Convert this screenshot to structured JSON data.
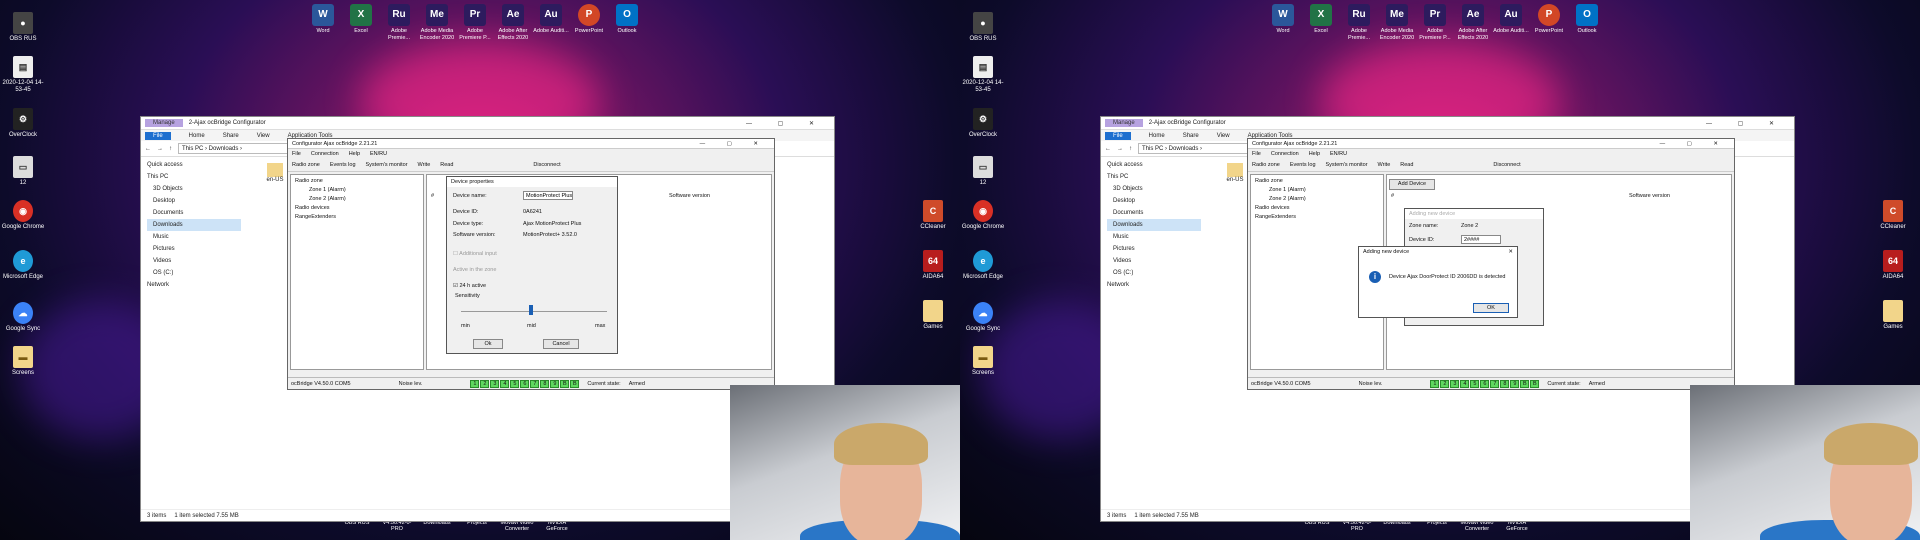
{
  "left": {
    "desktop_left": [
      {
        "label": "OBS RUS",
        "icon": "obs-icon",
        "color": "#444"
      },
      {
        "label": "2020-12-04 14-53-45",
        "icon": "file-icon",
        "color": "#eee"
      },
      {
        "label": "OverClock",
        "icon": "overclock-icon",
        "color": "#222"
      },
      {
        "label": "12",
        "icon": "file-icon",
        "color": "#ddd"
      },
      {
        "label": "Google Chrome",
        "icon": "chrome-icon",
        "color": "#d93025"
      },
      {
        "label": "Microsoft Edge",
        "icon": "edge-icon",
        "color": "#1f9ad6"
      },
      {
        "label": "Google Sync",
        "icon": "google-sync-icon",
        "color": "#3b82f6"
      },
      {
        "label": "Screens",
        "icon": "folder-icon",
        "color": "#f2d58a"
      }
    ],
    "desktop_top": [
      {
        "label": "Word",
        "text": "W",
        "color": "#2b579a"
      },
      {
        "label": "Excel",
        "text": "X",
        "color": "#217346"
      },
      {
        "label": "Adobe Premie...",
        "text": "Ru",
        "color": "#2d1b5e"
      },
      {
        "label": "Adobe Media Encoder 2020",
        "text": "Me",
        "color": "#2d1b5e"
      },
      {
        "label": "Adobe Premiere P...",
        "text": "Pr",
        "color": "#2d1b5e"
      },
      {
        "label": "Adobe After Effects 2020",
        "text": "Ae",
        "color": "#2d1b5e"
      },
      {
        "label": "Adobe Auditi...",
        "text": "Au",
        "color": "#2d1b5e"
      },
      {
        "label": "PowerPoint",
        "text": "P",
        "color": "#d24726"
      },
      {
        "label": "Outlook",
        "text": "O",
        "color": "#0072c6"
      }
    ],
    "desktop_right": [
      {
        "label": "CCleaner",
        "text": "C",
        "color": "#cf4b2a"
      },
      {
        "label": "AIDA64",
        "text": "64",
        "color": "#b81d1d"
      },
      {
        "label": "Games",
        "text": "",
        "color": "#f2d58a"
      }
    ],
    "taskbar": [
      "OBS RUS",
      "V4.50.42-0-PRO",
      "Downloads",
      "Projects",
      "Movavi Video Converter",
      "NVIDIA GeForce"
    ],
    "explorer": {
      "manage": "Manage",
      "title": "2-Ajax ocBridge Configurator",
      "tabs": [
        "File",
        "Home",
        "Share",
        "View",
        "Application Tools"
      ],
      "address": "This PC › Downloads ›",
      "nav": [
        "Quick access",
        "This PC",
        "3D Objects",
        "Desktop",
        "Documents",
        "Downloads",
        "Music",
        "Pictures",
        "Videos",
        "OS (C:)",
        "Network"
      ],
      "folder_item": "en-US",
      "status_items": "3 items",
      "status_selected": "1 item selected  7.55 MB"
    },
    "cfg": {
      "title": "Configurator Ajax ocBridge 2.21.21",
      "menu": [
        "File",
        "Connection",
        "Help",
        "EN/RU"
      ],
      "toolbar": [
        "Radio zone",
        "Events log",
        "System's monitor",
        "Write",
        "Read",
        "Disconnect"
      ],
      "tree": [
        "Radio zone",
        "Zone 1 (Alarm)",
        "Zone 2 (Alarm)",
        "Radio devices",
        "RangeExtenders"
      ],
      "col_hash": "#",
      "col_software": "Software version",
      "status_version": "ocBridge V4.50.0  COM5",
      "status_noise": "Noise lev.",
      "zones": [
        "1",
        "2",
        "3",
        "4",
        "5",
        "6",
        "7",
        "8",
        "9",
        "B",
        "B"
      ],
      "state_label": "Current state:",
      "state_value": "Armed"
    },
    "device_props": {
      "title": "Device properties",
      "name_label": "Device name:",
      "name_value": "MotionProtect Plus",
      "id_label": "Device ID:",
      "id_value": "0A6241",
      "type_label": "Device type:",
      "type_value": "Ajax MotionProtect Plus",
      "sw_label": "Software version:",
      "sw_value": "MotionProtect+ 3.52.0",
      "additional_input": "Additional input",
      "active_zone": "Active in the zone",
      "active_24h": "24 h active",
      "sensitivity": "Sensitivity",
      "min": "min",
      "mid": "mid",
      "max": "max",
      "ok": "Ok",
      "cancel": "Cancel"
    }
  },
  "right": {
    "explorer": {
      "manage": "Manage",
      "title": "2-Ajax ocBridge Configurator",
      "tabs": [
        "File",
        "Home",
        "Share",
        "View",
        "Application Tools"
      ],
      "address": "This PC › Downloads ›",
      "nav": [
        "Quick access",
        "This PC",
        "3D Objects",
        "Desktop",
        "Documents",
        "Downloads",
        "Music",
        "Pictures",
        "Videos",
        "OS (C:)",
        "Network"
      ],
      "folder_item": "en-US",
      "status_items": "3 items",
      "status_selected": "1 item selected  7.55 MB"
    },
    "cfg": {
      "title": "Configurator Ajax ocBridge 2.21.21",
      "menu": [
        "File",
        "Connection",
        "Help",
        "EN/RU"
      ],
      "toolbar": [
        "Radio zone",
        "Events log",
        "System's monitor",
        "Write",
        "Read",
        "Disconnect"
      ],
      "tree": [
        "Radio zone",
        "Zone 1 (Alarm)",
        "Zone 2 (Alarm)",
        "Radio devices",
        "RangeExtenders"
      ],
      "add_device": "Add Device",
      "col_hash": "#",
      "col_software": "Software version",
      "status_version": "ocBridge V4.50.0  COM5",
      "status_noise": "Noise lev.",
      "zones": [
        "1",
        "2",
        "3",
        "4",
        "5",
        "6",
        "7",
        "8",
        "9",
        "B",
        "B"
      ],
      "state_label": "Current state:",
      "state_value": "Armed"
    },
    "adding_bg": {
      "title": "Adding new device",
      "zone_label": "Zone name:",
      "zone_value": "Zone 2",
      "id_label": "Device ID:",
      "id_value": "2####"
    },
    "adding_msg": {
      "title": "Adding new device",
      "message": "Device Ajax DoorProtect ID 2006DD is detected",
      "ok": "OK"
    }
  }
}
